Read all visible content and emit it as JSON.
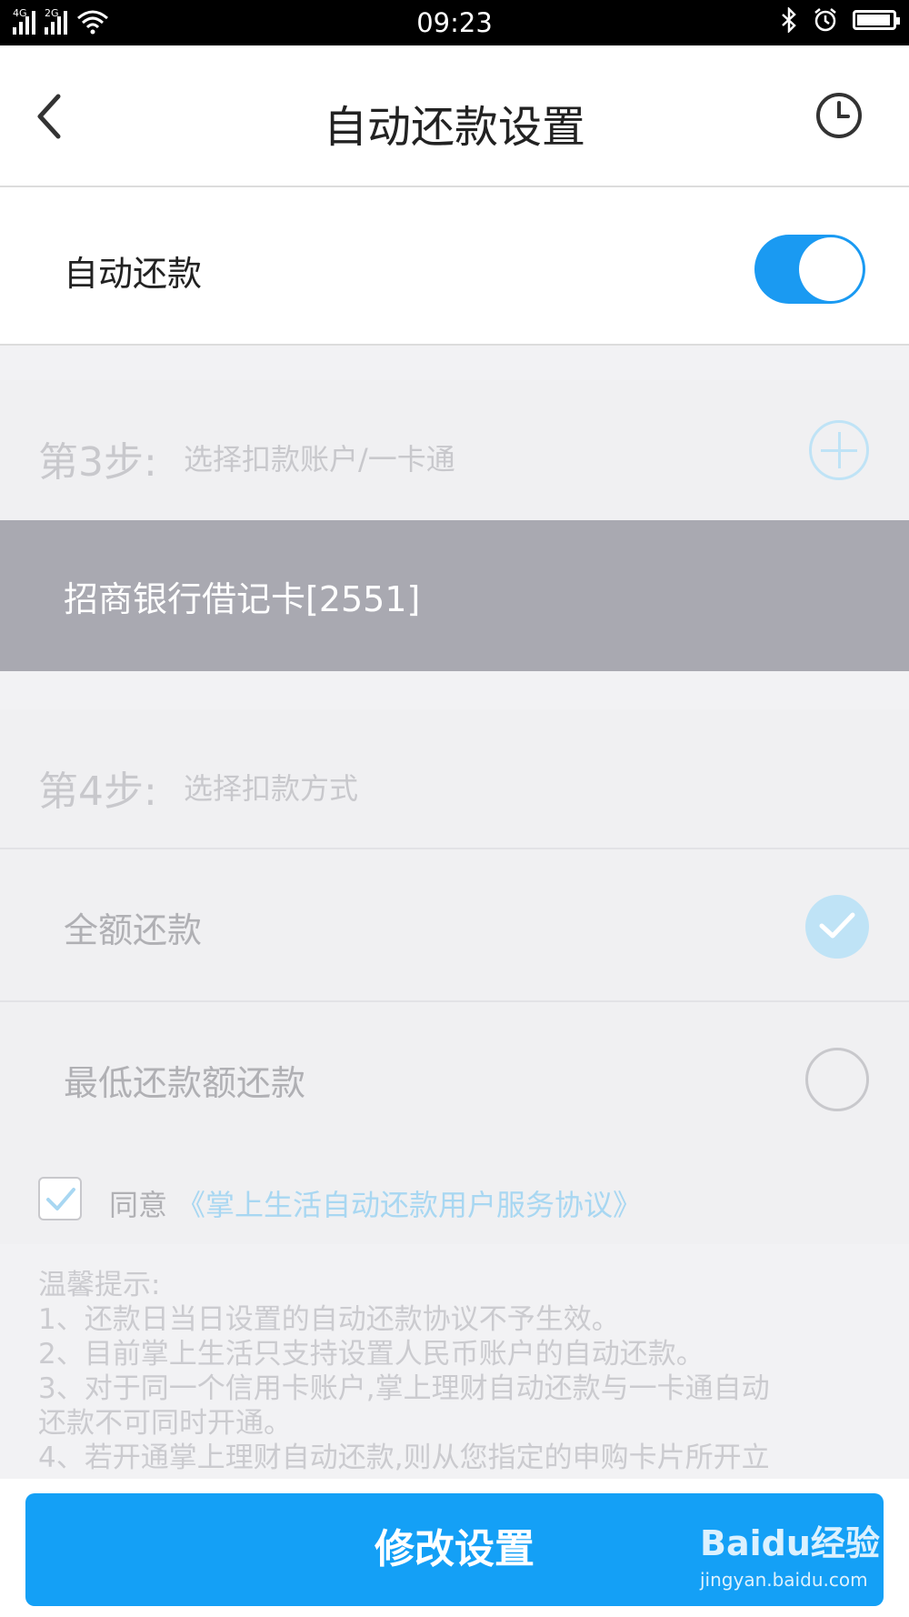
{
  "status_bar": {
    "time": "09:23",
    "network_1": "4G",
    "network_2": "2G",
    "battery_level": 0.95
  },
  "nav": {
    "title": "自动还款设置",
    "back_icon": "chevron-left-icon",
    "history_icon": "clock-icon"
  },
  "auto_repay": {
    "label": "自动还款",
    "enabled": true,
    "accent": "#1a9af2"
  },
  "step3": {
    "num": "第3步:",
    "text": "选择扣款账户/一卡通",
    "add_icon": "plus-circle-icon"
  },
  "selected_card": {
    "label": "招商银行借记卡[2551]"
  },
  "step4": {
    "num": "第4步:",
    "text": "选择扣款方式"
  },
  "options": [
    {
      "label": "全额还款",
      "selected": true
    },
    {
      "label": "最低还款额还款",
      "selected": false
    }
  ],
  "agreement": {
    "prefix": "同意",
    "link": "《掌上生活自动还款用户服务协议》",
    "checked": true
  },
  "tips": {
    "heading": "温馨提示:",
    "lines": [
      "1、还款日当日设置的自动还款协议不予生效。",
      "2、目前掌上生活只支持设置人民币账户的自动还款。",
      "3、对于同一个信用卡账户,掌上理财自动还款与一卡通自动",
      "还款不可同时开通。",
      "4、若开通掌上理财自动还款,则从您指定的申购卡片所开立"
    ]
  },
  "submit": {
    "label": "修改设置"
  },
  "watermark": {
    "brand": "Baidu经验",
    "url": "jingyan.baidu.com"
  }
}
